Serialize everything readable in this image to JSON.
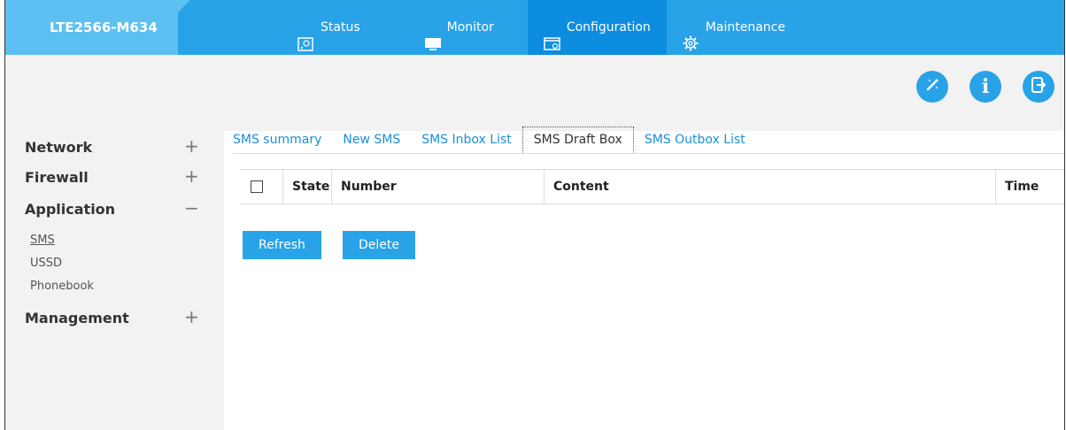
{
  "header": {
    "brand": "LTE2566-M634",
    "nav": [
      {
        "label": "Status",
        "icon": "status-icon"
      },
      {
        "label": "Monitor",
        "icon": "monitor-icon"
      },
      {
        "label": "Configuration",
        "icon": "configuration-icon"
      },
      {
        "label": "Maintenance",
        "icon": "maintenance-icon"
      }
    ],
    "active_nav": "Configuration",
    "tools": [
      {
        "icon": "wizard-icon"
      },
      {
        "icon": "info-icon",
        "glyph": "i"
      },
      {
        "icon": "logout-icon"
      }
    ]
  },
  "sidebar": {
    "groups": [
      {
        "label": "Network",
        "toggle": "+"
      },
      {
        "label": "Firewall",
        "toggle": "+"
      },
      {
        "label": "Application",
        "toggle": "−"
      },
      {
        "label": "Management",
        "toggle": "+"
      }
    ],
    "application_items": [
      "SMS",
      "USSD",
      "Phonebook"
    ],
    "active_item": "SMS"
  },
  "main": {
    "tabs": [
      "SMS summary",
      "New SMS",
      "SMS Inbox List",
      "SMS Draft Box",
      "SMS Outbox List"
    ],
    "active_tab": "SMS Draft Box",
    "table": {
      "columns": [
        "State",
        "Number",
        "Content",
        "Time"
      ],
      "rows": []
    },
    "buttons": {
      "refresh": "Refresh",
      "delete": "Delete"
    }
  },
  "colors": {
    "topbar": "#29a3e8",
    "brand": "#5cc0f2",
    "active_nav": "#0d8de0",
    "link": "#1a8fd6"
  }
}
